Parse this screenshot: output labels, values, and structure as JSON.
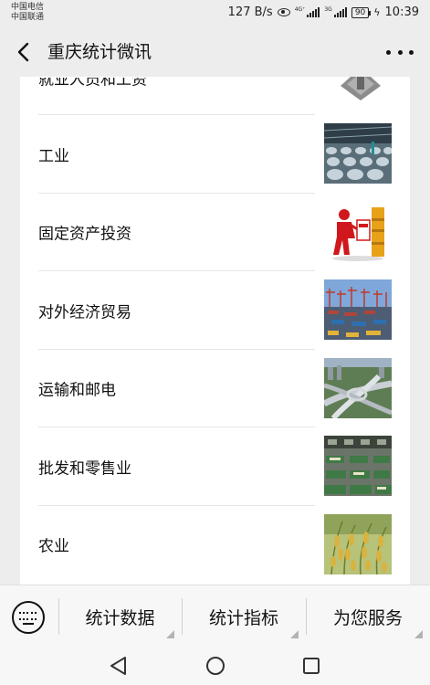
{
  "status_bar": {
    "carrier_1": "中国电信",
    "carrier_2": "中国联通",
    "net_speed": "127 B/s",
    "net_type_1": "4G⁺",
    "net_type_2": "3G",
    "battery": "90",
    "time": "10:39"
  },
  "header": {
    "title": "重庆统计微讯",
    "back_icon": "chevron-left-icon",
    "more_icon": "more-dots-icon"
  },
  "list": {
    "partial_item": "就业人员和工资",
    "items": [
      {
        "label": "工业",
        "thumb": "factory-photo"
      },
      {
        "label": "固定资产投资",
        "thumb": "investment-photo"
      },
      {
        "label": "对外经济贸易",
        "thumb": "port-photo"
      },
      {
        "label": "运输和邮电",
        "thumb": "highway-photo"
      },
      {
        "label": "批发和零售业",
        "thumb": "market-photo"
      },
      {
        "label": "农业",
        "thumb": "rice-photo"
      }
    ]
  },
  "menu": {
    "keyboard_icon": "keyboard-icon",
    "items": [
      "统计数据",
      "统计指标",
      "为您服务"
    ]
  },
  "nav": {
    "back_icon": "nav-back-icon",
    "home_icon": "nav-home-icon",
    "recents_icon": "nav-recents-icon"
  },
  "colors": {
    "background": "#ededed",
    "panel": "#ffffff",
    "menu_bar": "#f7f7f7"
  }
}
